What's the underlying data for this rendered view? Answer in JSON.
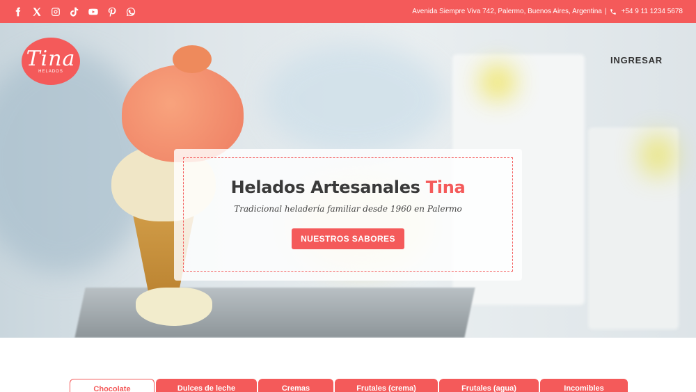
{
  "topbar": {
    "socials": [
      {
        "name": "facebook-icon"
      },
      {
        "name": "x-icon"
      },
      {
        "name": "instagram-icon"
      },
      {
        "name": "tiktok-icon"
      },
      {
        "name": "youtube-icon"
      },
      {
        "name": "pinterest-icon"
      },
      {
        "name": "whatsapp-icon"
      }
    ],
    "address": "Avenida Siempre Viva 742, Palermo, Buenos Aires, Argentina",
    "separator": "|",
    "phone": "+54 9 11 1234 5678"
  },
  "header": {
    "logo_text": "Tina",
    "logo_sub": "HELADOS",
    "login_label": "INGRESAR"
  },
  "hero": {
    "title_main": "Helados Artesanales",
    "title_accent": "Tina",
    "subtitle": "Tradicional heladería familiar desde 1960 en Palermo",
    "cta_label": "NUESTROS SABORES"
  },
  "tabs": [
    {
      "label": "Chocolate",
      "active": true
    },
    {
      "label": "Dulces de leche",
      "active": false
    },
    {
      "label": "Cremas",
      "active": false
    },
    {
      "label": "Frutales (crema)",
      "active": false
    },
    {
      "label": "Frutales (agua)",
      "active": false
    },
    {
      "label": "Incomibles",
      "active": false
    }
  ],
  "colors": {
    "accent": "#f45a5a",
    "text_dark": "#3a3a3a"
  }
}
